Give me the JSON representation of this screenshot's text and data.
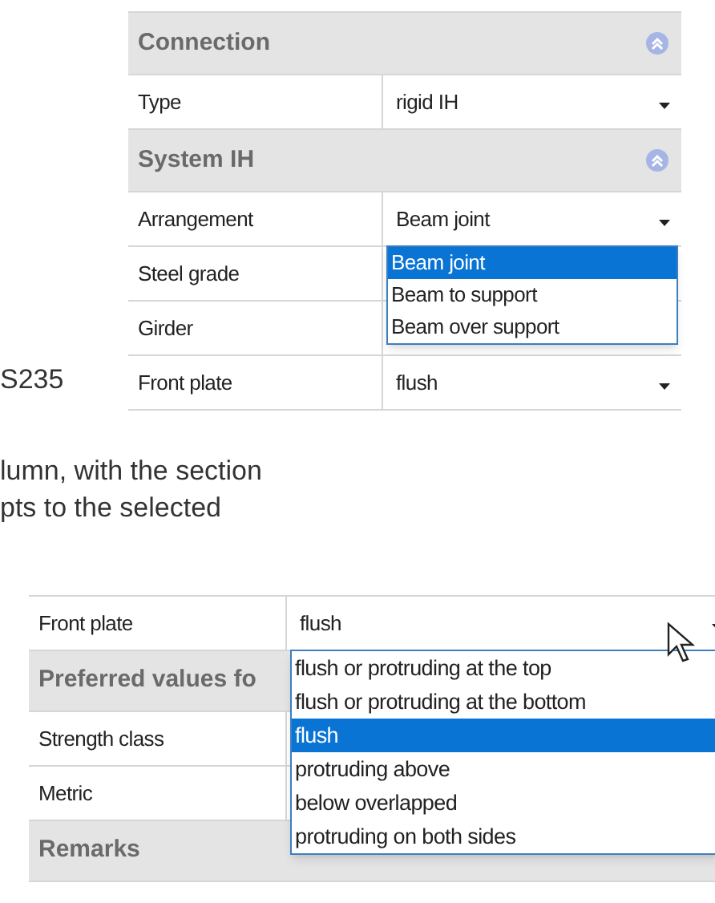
{
  "grid_top": {
    "rows": [
      {
        "kind": "header",
        "label": "Connection",
        "expanded": true
      },
      {
        "kind": "select",
        "label": "Type",
        "value": "rigid IH"
      },
      {
        "kind": "header",
        "label": "System IH",
        "expanded": true
      },
      {
        "kind": "select",
        "label": "Arrangement",
        "value": "Beam joint",
        "dropdown": [
          {
            "label": "Beam joint",
            "selected": true
          },
          {
            "label": "Beam to support",
            "selected": false
          },
          {
            "label": "Beam over support",
            "selected": false
          }
        ]
      },
      {
        "kind": "field",
        "label": "Steel grade"
      },
      {
        "kind": "field",
        "label": "Girder"
      },
      {
        "kind": "select",
        "label": "Front plate",
        "value": "flush"
      }
    ]
  },
  "side_text": "S235",
  "paragraph_lines": [
    "lumn, with the section",
    "pts to the selected"
  ],
  "grid_bottom": {
    "rows": [
      {
        "kind": "select",
        "label": "Front plate",
        "value": "flush",
        "dropdown": [
          {
            "label": "flush or protruding at the top",
            "selected": false
          },
          {
            "label": "flush or protruding at the bottom",
            "selected": false
          },
          {
            "label": "flush",
            "selected": true
          },
          {
            "label": "protruding above",
            "selected": false
          },
          {
            "label": "below overlapped",
            "selected": false
          },
          {
            "label": "protruding on both sides",
            "selected": false
          }
        ]
      },
      {
        "kind": "header",
        "label": "Preferred values fo"
      },
      {
        "kind": "field",
        "label": "Strength class"
      },
      {
        "kind": "field",
        "label": "Metric"
      },
      {
        "kind": "header",
        "label": "Remarks"
      }
    ]
  }
}
